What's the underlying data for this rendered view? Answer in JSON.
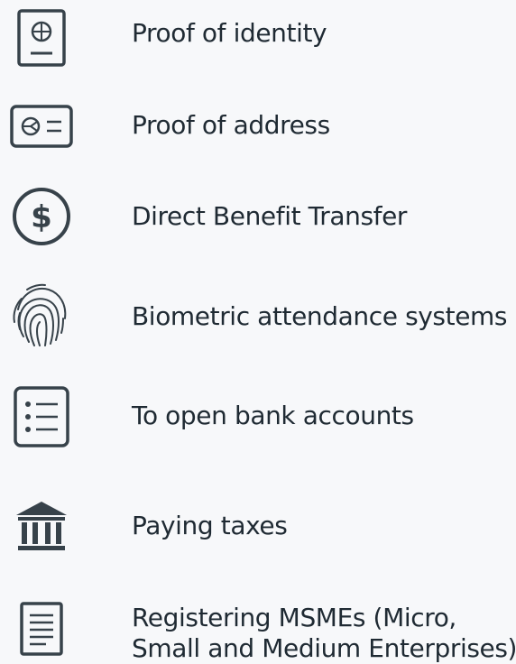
{
  "items": [
    {
      "label": "Proof of identity",
      "icon": "passport-icon"
    },
    {
      "label": "Proof of address",
      "icon": "address-card-icon"
    },
    {
      "label": "Direct Benefit Transfer",
      "icon": "dollar-coin-icon"
    },
    {
      "label": "Biometric attendance systems",
      "icon": "fingerprint-icon"
    },
    {
      "label": "To open bank accounts",
      "icon": "list-document-icon"
    },
    {
      "label": "Paying taxes",
      "icon": "bank-building-icon"
    },
    {
      "label_lines": [
        "Registering MSMEs (Micro,",
        "Small and Medium Enterprises)"
      ],
      "icon": "registration-document-icon"
    }
  ],
  "colors": {
    "icon_stroke": "#37424a",
    "text": "#1f2a33",
    "background": "#f7f8fa"
  }
}
